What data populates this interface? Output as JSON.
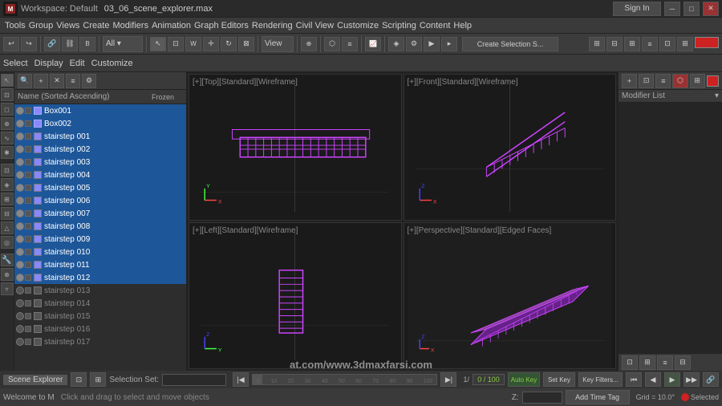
{
  "app": {
    "title": "Workspace: Default",
    "filename": "03_06_scene_explorer.max"
  },
  "menu": {
    "items": [
      "Tools",
      "Group",
      "Views",
      "Create",
      "Modifiers",
      "Animation",
      "Graph Editors",
      "Rendering",
      "Civil View",
      "Customize",
      "Scripting",
      "Content",
      "Help"
    ]
  },
  "toolbar": {
    "selection_set": "Create Selection S...",
    "view_label": "View"
  },
  "action_bar": {
    "items": [
      "Select",
      "Display",
      "Edit",
      "Customize"
    ]
  },
  "scene_explorer": {
    "title": "Scene Explorer",
    "selection_set_label": "Selection Set:",
    "column_name": "Name (Sorted Ascending)",
    "column_frozen": "Frozen",
    "objects": [
      {
        "name": "Box001",
        "visible": true,
        "selected": true
      },
      {
        "name": "Box002",
        "visible": true,
        "selected": true
      },
      {
        "name": "stairstep 001",
        "visible": true,
        "selected": true
      },
      {
        "name": "stairstep 002",
        "visible": true,
        "selected": true
      },
      {
        "name": "stairstep 003",
        "visible": true,
        "selected": true
      },
      {
        "name": "stairstep 004",
        "visible": true,
        "selected": true
      },
      {
        "name": "stairstep 005",
        "visible": true,
        "selected": true
      },
      {
        "name": "stairstep 006",
        "visible": true,
        "selected": true
      },
      {
        "name": "stairstep 007",
        "visible": true,
        "selected": true
      },
      {
        "name": "stairstep 008",
        "visible": true,
        "selected": true
      },
      {
        "name": "stairstep 009",
        "visible": true,
        "selected": true
      },
      {
        "name": "stairstep 010",
        "visible": true,
        "selected": true
      },
      {
        "name": "stairstep 011",
        "visible": true,
        "selected": true
      },
      {
        "name": "stairstep 012",
        "visible": true,
        "selected": true
      },
      {
        "name": "stairstep 013",
        "visible": false,
        "selected": false
      },
      {
        "name": "stairstep 014",
        "visible": false,
        "selected": false
      },
      {
        "name": "stairstep 015",
        "visible": false,
        "selected": false
      },
      {
        "name": "stairstep 016",
        "visible": false,
        "selected": false
      },
      {
        "name": "stairstep 017",
        "visible": false,
        "selected": false
      }
    ]
  },
  "viewports": {
    "top": "[+][Top][Standard][Wireframe]",
    "front": "[+][Front][Standard][Wireframe]",
    "left": "[+][Left][Standard][Wireframe]",
    "perspective": "[+][Perspective][Standard][Edged Faces]"
  },
  "modifier_list": {
    "label": "Modifier List"
  },
  "timeline": {
    "current_frame": "0",
    "total_frames": "100",
    "display": "0 / 100"
  },
  "status": {
    "select_help": "Click and drag to select and move objects",
    "grid": "Grid = 10.0°",
    "auto_key": "Auto Key",
    "selected_label": "Selected",
    "set_key": "Set Key",
    "key_filters": "Key Filters..."
  },
  "coord": {
    "z_label": "Z:",
    "z_value": ""
  },
  "watermark": "at.com/www.3dmaxfarsi.com",
  "welcome": "Welcome to M"
}
